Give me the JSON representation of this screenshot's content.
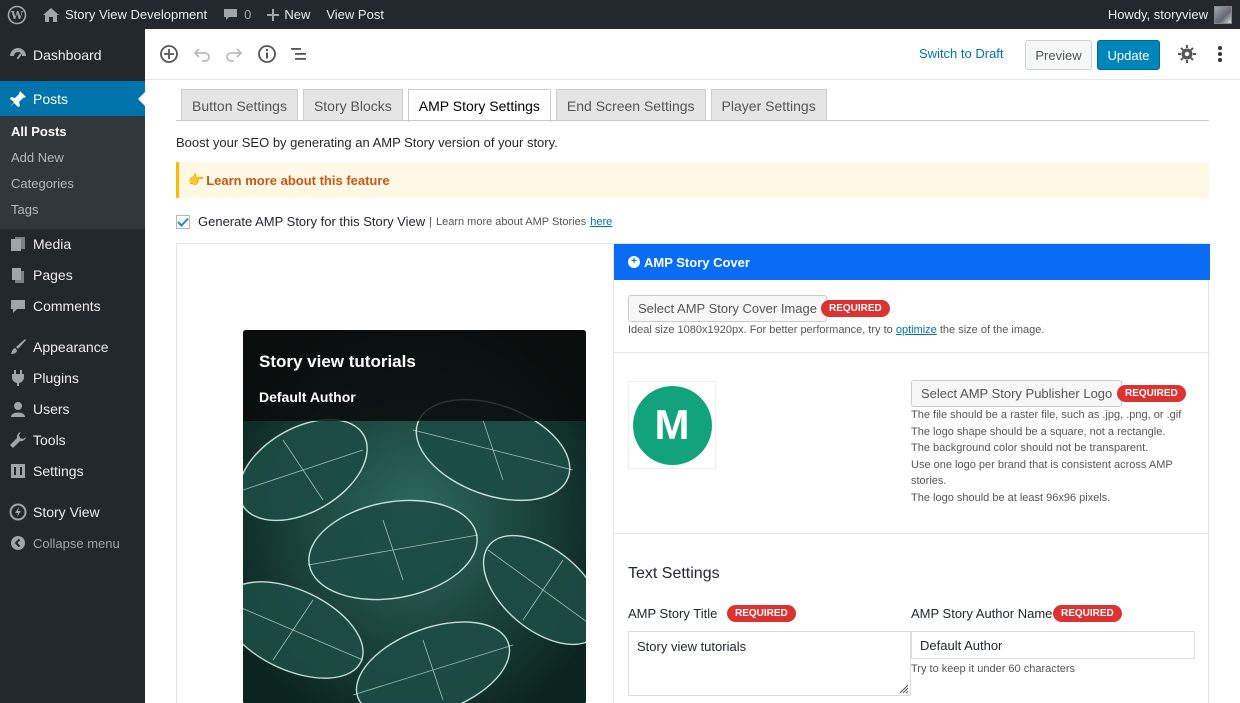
{
  "admin_bar": {
    "site_name": "Story View Development",
    "comments_count": "0",
    "new_label": "New",
    "view_post_label": "View Post",
    "howdy": "Howdy, storyview"
  },
  "sidebar": {
    "items": [
      {
        "label": "Dashboard",
        "icon": "dashboard-icon"
      },
      {
        "label": "Posts",
        "icon": "pin-icon"
      },
      {
        "label": "Media",
        "icon": "media-icon"
      },
      {
        "label": "Pages",
        "icon": "pages-icon"
      },
      {
        "label": "Comments",
        "icon": "comments-icon"
      },
      {
        "label": "Appearance",
        "icon": "brush-icon"
      },
      {
        "label": "Plugins",
        "icon": "plugins-icon"
      },
      {
        "label": "Users",
        "icon": "users-icon"
      },
      {
        "label": "Tools",
        "icon": "wrench-icon"
      },
      {
        "label": "Settings",
        "icon": "settings-icon"
      },
      {
        "label": "Story View",
        "icon": "story-view-icon"
      }
    ],
    "submenu": [
      "All Posts",
      "Add New",
      "Categories",
      "Tags"
    ],
    "collapse_label": "Collapse menu"
  },
  "editor_header": {
    "switch_to_draft": "Switch to Draft",
    "preview": "Preview",
    "update": "Update"
  },
  "tabs": [
    "Button Settings",
    "Story Blocks",
    "AMP Story Settings",
    "End Screen Settings",
    "Player Settings"
  ],
  "active_tab": "AMP Story Settings",
  "intro_text": "Boost your SEO by generating an AMP Story version of your story.",
  "notice": {
    "emoji": "👉",
    "text": "Learn more about this feature"
  },
  "generate_checkbox": {
    "checked": true,
    "label": "Generate AMP Story for this Story View",
    "separator": "|",
    "learn_more": "Learn more about AMP Stories",
    "link": "here"
  },
  "preview_card": {
    "title": "Story view tutorials",
    "author": "Default Author"
  },
  "cover": {
    "header": "AMP Story Cover",
    "select_image_button": "Select AMP Story Cover Image",
    "required": "REQUIRED",
    "help_before": "Ideal size 1080x1920px. For better performance, try to",
    "help_link": "optimize",
    "help_after": "the size of the image."
  },
  "publisher_logo": {
    "logo_letter": "M",
    "select_button": "Select AMP Story Publisher Logo",
    "required": "REQUIRED",
    "rules": [
      "The file should be a raster file, such as .jpg, .png, or .gif",
      "The logo shape should be a square, not a rectangle.",
      "The background color should not be transparent.",
      "Use one logo per brand that is consistent across AMP",
      "stories.",
      "The logo should be at least 96x96 pixels."
    ]
  },
  "text_settings": {
    "heading": "Text Settings",
    "title_label": "AMP Story Title",
    "title_required": "REQUIRED",
    "title_value": "Story view tutorials",
    "author_label": "AMP Story Author Name",
    "author_required": "REQUIRED",
    "author_value": "Default Author",
    "author_help": "Try to keep it under 60 characters"
  },
  "colors": {
    "admin_dark": "#23282d",
    "accent_blue": "#0073aa",
    "cover_header_blue": "#0a6cf5",
    "required_red": "#dc3232",
    "logo_green": "#12a37c"
  }
}
